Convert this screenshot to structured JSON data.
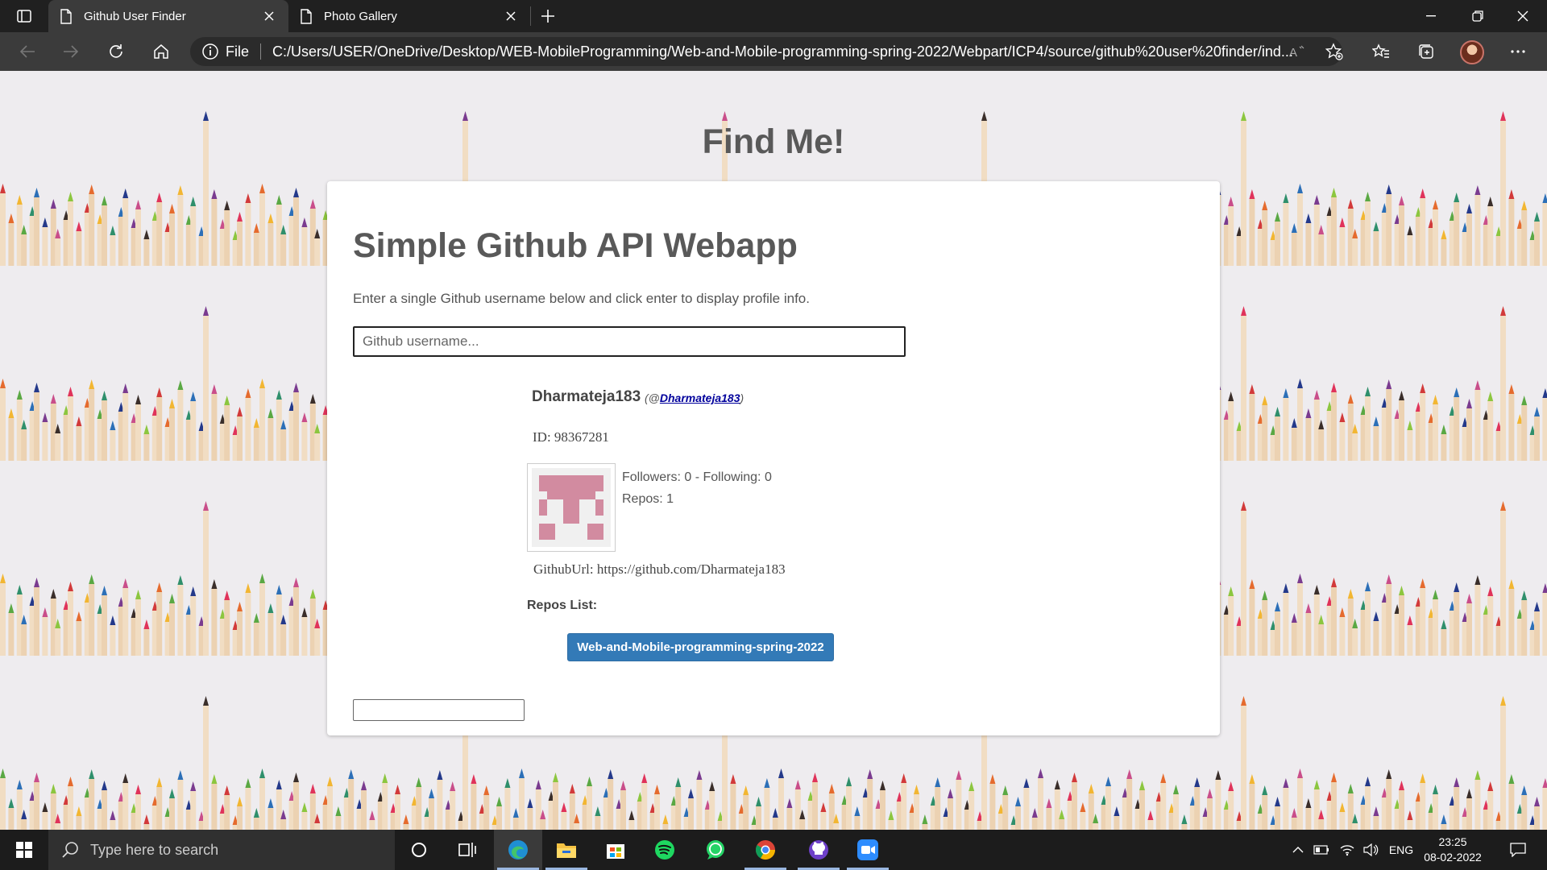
{
  "browser": {
    "tabs": [
      {
        "label": "Github User Finder",
        "active": true
      },
      {
        "label": "Photo Gallery",
        "active": false
      }
    ],
    "address": {
      "scheme_label": "File",
      "url": "C:/Users/USER/OneDrive/Desktop/WEB-MobileProgramming/Web-and-Mobile-programming-spring-2022/Webpart/ICP4/source/github%20user%20finder/ind..."
    },
    "icons": [
      "sidebar-toggle-icon",
      "page-icon",
      "close-icon",
      "plus-icon",
      "minimize-icon",
      "restore-icon",
      "back-icon",
      "forward-icon",
      "refresh-icon",
      "home-icon",
      "info-icon",
      "read-aloud-icon",
      "add-favorite-icon",
      "favorites-icon",
      "collections-icon",
      "more-icon"
    ]
  },
  "page": {
    "heading": "Find Me!",
    "card": {
      "title": "Simple Github API Webapp",
      "intro": "Enter a single Github username below and click enter to display profile info.",
      "search_placeholder": "Github username...",
      "search_value": ""
    },
    "profile": {
      "name": "Dharmateja183",
      "handle_prefix": "(@",
      "handle": "Dharmateja183",
      "handle_suffix": ")",
      "id_text": "ID: 98367281",
      "stats_line1": "Followers: 0 - Following: 0",
      "stats_line2": "Repos: 1",
      "github_url_text": "GithubUrl: https://github.com/Dharmateja183",
      "repos_heading": "Repos List:",
      "repos": [
        "Web-and-Mobile-programming-spring-2022"
      ],
      "identicon_color": "#d28ba0"
    }
  },
  "taskbar": {
    "search_placeholder": "Type here to search",
    "apps": [
      "cortana-icon",
      "task-view-icon",
      "edge-icon",
      "file-explorer-icon",
      "microsoft-store-icon",
      "spotify-icon",
      "whatsapp-icon",
      "chrome-icon",
      "github-desktop-icon",
      "zoom-icon"
    ],
    "language": "ENG",
    "time": "23:25",
    "date": "08-02-2022"
  },
  "colors": {
    "chrome_dark": "#202020",
    "chrome_toolbar": "#3b3b3b",
    "repo_button": "#337ab7",
    "heading_gray": "#595959"
  }
}
